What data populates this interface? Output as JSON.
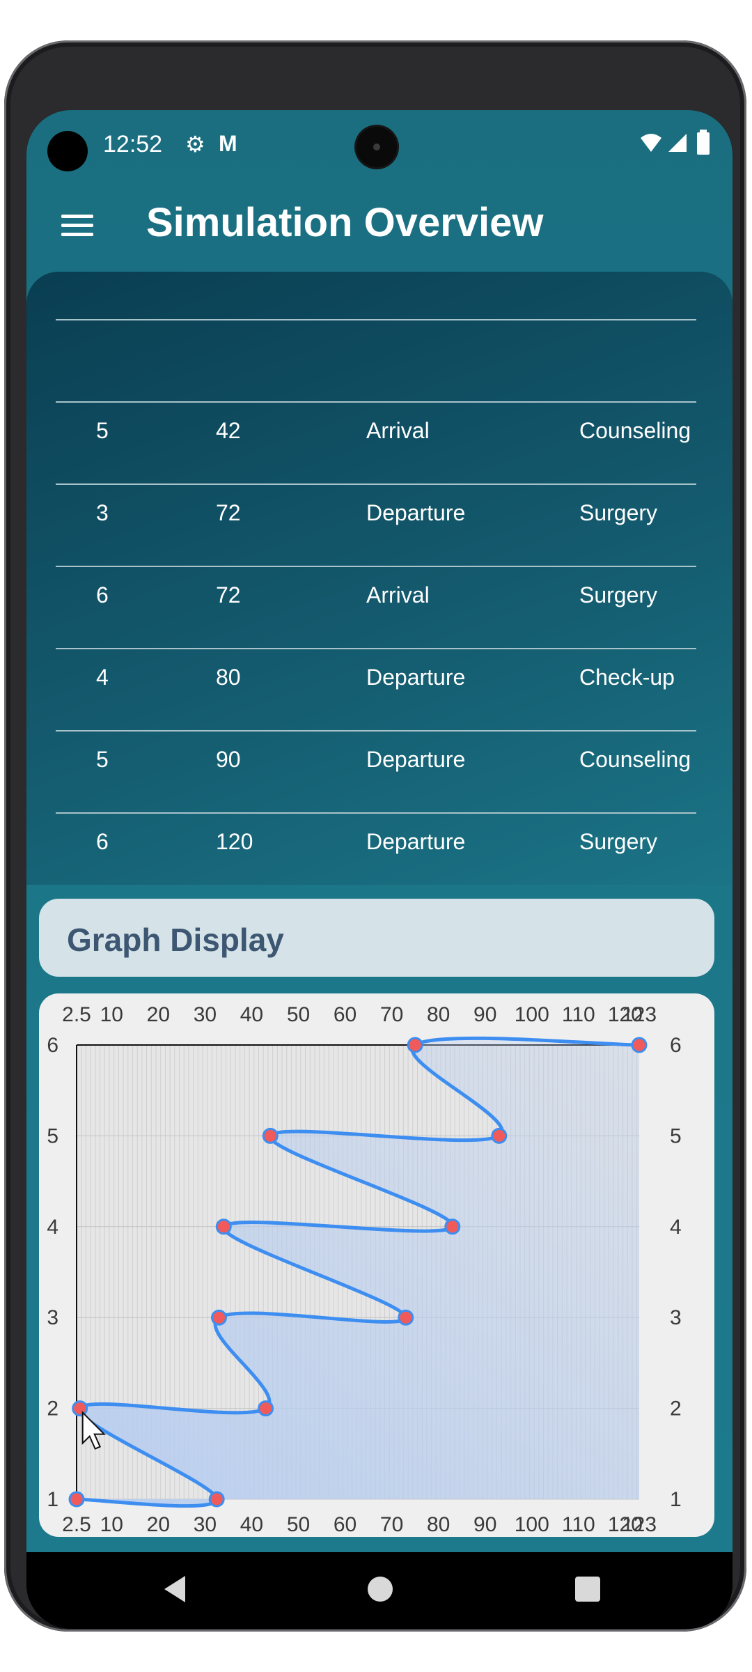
{
  "status_bar": {
    "time": "12:52",
    "icons": [
      "settings-icon",
      "gmail-icon",
      "wifi-icon",
      "signal-icon",
      "battery-icon"
    ]
  },
  "app_bar": {
    "title": "Simulation Overview",
    "menu_icon": "hamburger-menu-icon"
  },
  "table": {
    "rows": [
      [
        "5",
        "42",
        "Arrival",
        "Counseling"
      ],
      [
        "3",
        "72",
        "Departure",
        "Surgery"
      ],
      [
        "6",
        "72",
        "Arrival",
        "Surgery"
      ],
      [
        "4",
        "80",
        "Departure",
        "Check-up"
      ],
      [
        "5",
        "90",
        "Departure",
        "Counseling"
      ],
      [
        "6",
        "120",
        "Departure",
        "Surgery"
      ]
    ]
  },
  "graph_section": {
    "title": "Graph Display"
  },
  "chart_data": {
    "type": "line",
    "x_tick_labels": [
      "2.5",
      "10",
      "20",
      "30",
      "40",
      "50",
      "60",
      "70",
      "80",
      "90",
      "100",
      "110",
      "120",
      "123"
    ],
    "y_tick_labels": [
      "1",
      "2",
      "3",
      "4",
      "5",
      "6"
    ],
    "xlim": [
      2.5,
      123
    ],
    "ylim": [
      1,
      6
    ],
    "grid": true,
    "fill_area": true,
    "colors": {
      "line": "#3d8ef0",
      "point": "#f05a5a",
      "fill": "#b7cdef"
    },
    "x": [
      2.5,
      32.5,
      43,
      33,
      73,
      34,
      83,
      44,
      93,
      75,
      123
    ],
    "y": [
      1,
      1,
      2,
      2,
      3,
      3,
      4,
      4,
      5,
      5,
      6
    ],
    "points": [
      {
        "x": 2.5,
        "y": 1
      },
      {
        "x": 32.5,
        "y": 1
      },
      {
        "x": 3.2,
        "y": 2
      },
      {
        "x": 43,
        "y": 2
      },
      {
        "x": 33,
        "y": 3
      },
      {
        "x": 73,
        "y": 3
      },
      {
        "x": 34,
        "y": 4
      },
      {
        "x": 83,
        "y": 4
      },
      {
        "x": 44,
        "y": 5
      },
      {
        "x": 93,
        "y": 5
      },
      {
        "x": 75,
        "y": 6
      },
      {
        "x": 123,
        "y": 6
      }
    ]
  },
  "nav_bar": {
    "buttons": [
      "back-icon",
      "home-icon",
      "recents-icon"
    ]
  }
}
